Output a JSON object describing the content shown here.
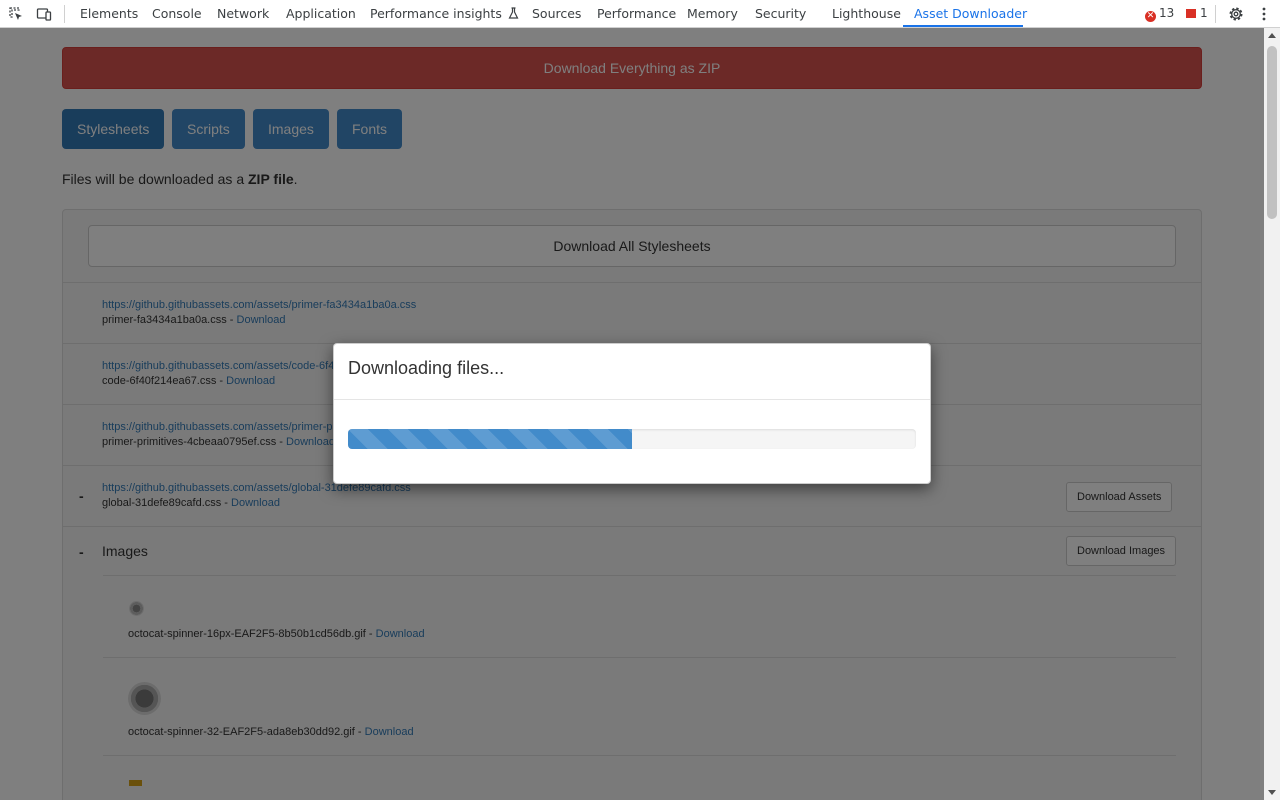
{
  "devtools": {
    "tabs": [
      "Elements",
      "Console",
      "Network",
      "Application",
      "Performance insights",
      "Sources",
      "Performance",
      "Memory",
      "Security",
      "Lighthouse",
      "Asset Downloader"
    ],
    "active_tab": "Asset Downloader",
    "error_count": "13",
    "issue_count": "1"
  },
  "page": {
    "zip_button": "Download Everything as ZIP",
    "tabs": [
      "Stylesheets",
      "Scripts",
      "Images",
      "Fonts"
    ],
    "active_tab": "Stylesheets",
    "info_prefix": "Files will be downloaded as a",
    "info_bold": "ZIP file",
    "info_suffix": ".",
    "download_all": "Download All Stylesheets",
    "stylesheets": [
      {
        "url": "https://github.githubassets.com/assets/primer-fa3434a1ba0a.css",
        "name": "primer-fa3434a1ba0a.css",
        "link": "Download"
      },
      {
        "url": "https://github.githubassets.com/assets/code-6f40f214ea67.css",
        "name": "code-6f40f214ea67.css",
        "link": "Download"
      },
      {
        "url": "https://github.githubassets.com/assets/primer-primitives-4cbeaa0795ef.css",
        "name": "primer-primitives-4cbeaa0795ef.css",
        "link": "Download"
      },
      {
        "url": "https://github.githubassets.com/assets/global-31defe89cafd.css",
        "name": "global-31defe89cafd.css",
        "link": "Download"
      }
    ],
    "separator": " - ",
    "minus": "-",
    "download_assets": "Download Assets",
    "images_title": "Images",
    "download_images": "Download Images",
    "images": [
      {
        "name": "octocat-spinner-16px-EAF2F5-8b50b1cd56db.gif",
        "link": "Download"
      },
      {
        "name": "octocat-spinner-32-EAF2F5-ada8eb30dd92.gif",
        "link": "Download"
      }
    ]
  },
  "modal": {
    "title": "Downloading files...",
    "progress": 0.5
  },
  "colors": {
    "danger": "#d9534f",
    "primary": "#428bca",
    "primary_active": "#337ab7",
    "devtools_accent": "#1a73e8"
  }
}
